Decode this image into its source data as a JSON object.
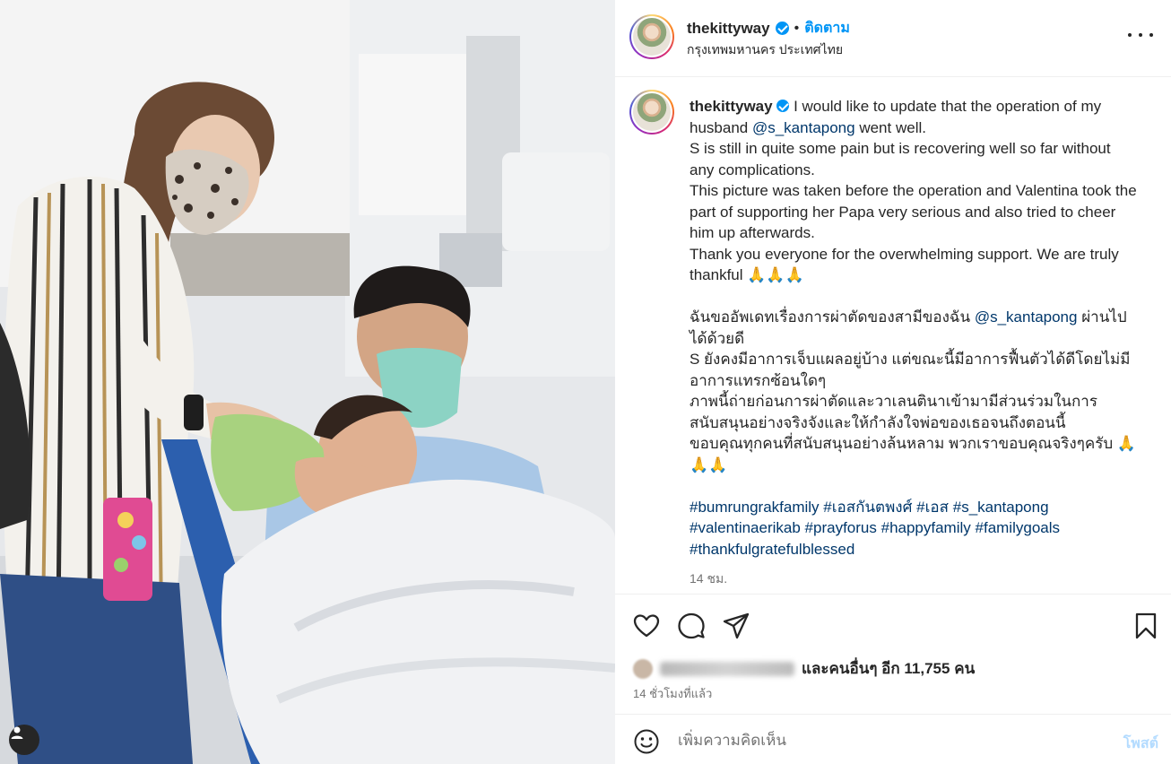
{
  "post": {
    "username": "thekittyway",
    "follow_label": "ติดตาม",
    "separator": "•",
    "location": "กรุงเทพมหานคร ประเทศไทย"
  },
  "caption": {
    "username": "thekittyway",
    "en_1a": "I would like to update that the operation of my husband",
    "mention_1": "@s_kantapong",
    "en_1b": "went well.",
    "en_2": "S is still in quite some pain but is recovering well so far without any complications.",
    "en_3": "This picture was taken before the operation and Valentina took the part of supporting her Papa very serious and also tried to cheer him up afterwards.",
    "en_4": "Thank you everyone for the overwhelming support. We are truly thankful 🙏🙏🙏",
    "th_1a": "ฉันขออัพเดทเรื่องการผ่าตัดของสามีของฉัน",
    "mention_2": "@s_kantapong",
    "th_1b": "ผ่านไปได้ด้วยดี",
    "th_2": "S ยังคงมีอาการเจ็บแผลอยู่บ้าง แต่ขณะนี้มีอาการฟื้นตัวได้ดีโดยไม่มีอาการแทรกซ้อนใดๆ",
    "th_3": "ภาพนี้ถ่ายก่อนการผ่าตัดและวาเลนตินาเข้ามามีส่วนร่วมในการสนับสนุนอย่างจริงจังและให้กำลังใจพ่อของเธอจนถึงตอนนี้",
    "th_4": "ขอบคุณทุกคนที่สนับสนุนอย่างล้นหลาม พวกเราขอบคุณจริงๆครับ 🙏🙏🙏",
    "hashtags": [
      "#bumrungrakfamily",
      "#เอสกันตพงศ์",
      "#เอส",
      "#s_kantapong",
      "#valentinaerikab",
      "#prayforus",
      "#happyfamily",
      "#familygoals",
      "#thankfulgratefulblessed"
    ],
    "age": "14 ชม."
  },
  "likes": {
    "text": "และคนอื่นๆ อีก 11,755 คน"
  },
  "post_time": "14 ชั่วโมงที่แล้ว",
  "comment": {
    "placeholder": "เพิ่มความคิดเห็น",
    "post_label": "โพสต์"
  },
  "icons": {
    "heart": "heart-icon",
    "comment": "comment-icon",
    "share": "share-icon",
    "save": "bookmark-icon",
    "more": "more-icon",
    "emoji": "emoji-icon",
    "user": "user-icon"
  },
  "colors": {
    "link": "#00376b",
    "accent": "#0095f6",
    "verified": "#0095f6",
    "post_button_disabled": "#b3dbff"
  }
}
